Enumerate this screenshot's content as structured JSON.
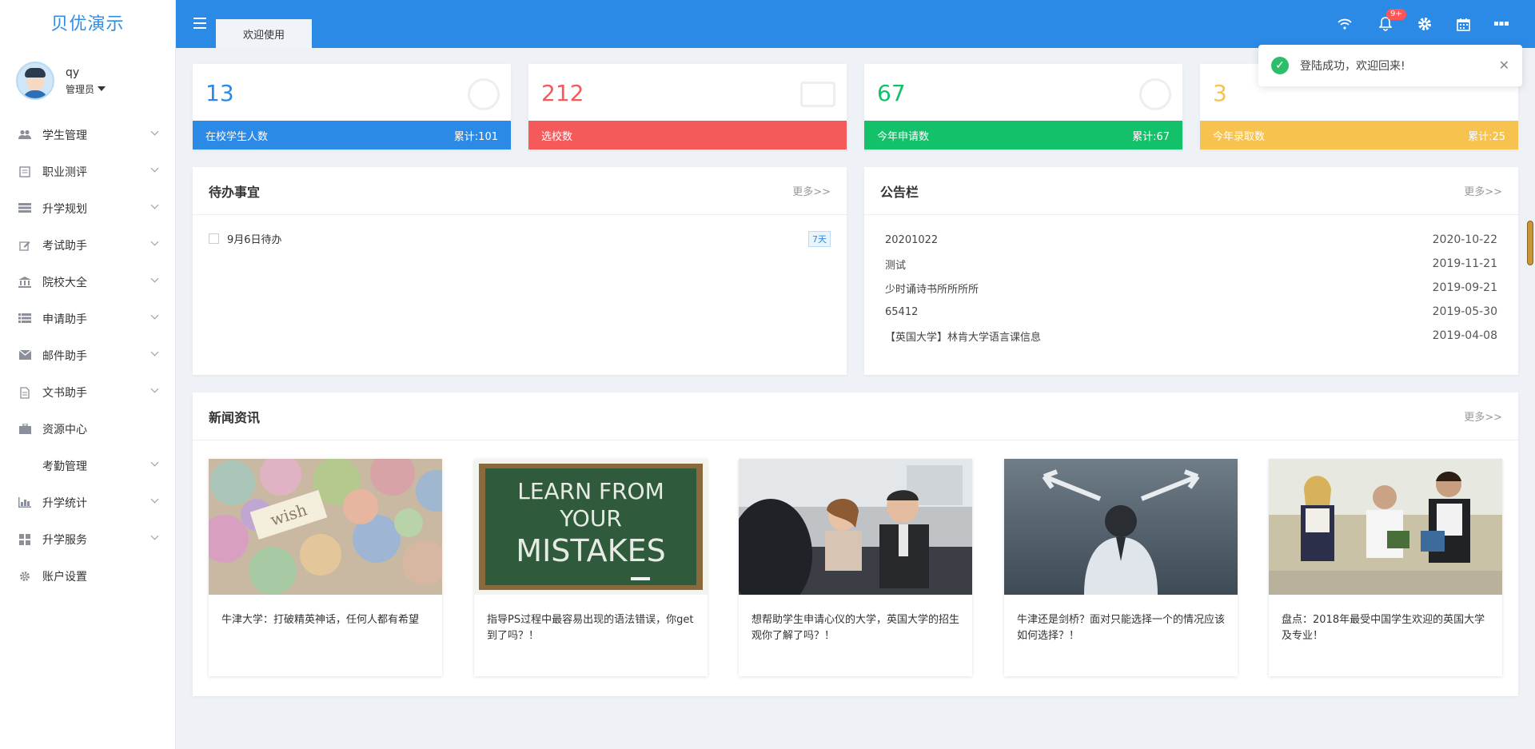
{
  "brand": "贝优演示",
  "user": {
    "name": "qy",
    "role": "管理员"
  },
  "sidebar": {
    "items": [
      {
        "label": "学生管理",
        "icon": "users-icon",
        "has_sub": true
      },
      {
        "label": "职业测评",
        "icon": "clipboard-icon",
        "has_sub": true
      },
      {
        "label": "升学规划",
        "icon": "server-icon",
        "has_sub": true
      },
      {
        "label": "考试助手",
        "icon": "edit-icon",
        "has_sub": true
      },
      {
        "label": "院校大全",
        "icon": "bank-icon",
        "has_sub": true
      },
      {
        "label": "申请助手",
        "icon": "list-icon",
        "has_sub": true
      },
      {
        "label": "邮件助手",
        "icon": "envelope-icon",
        "has_sub": true
      },
      {
        "label": "文书助手",
        "icon": "file-icon",
        "has_sub": true
      },
      {
        "label": "资源中心",
        "icon": "briefcase-icon",
        "has_sub": false
      },
      {
        "label": "考勤管理",
        "icon": "",
        "has_sub": true
      },
      {
        "label": "升学统计",
        "icon": "bar-chart-icon",
        "has_sub": true
      },
      {
        "label": "升学服务",
        "icon": "grid-icon",
        "has_sub": true
      },
      {
        "label": "账户设置",
        "icon": "gear-icon",
        "has_sub": false
      }
    ]
  },
  "header": {
    "tab": "欢迎使用",
    "badge": "9+",
    "icons": [
      "wifi-icon",
      "bell-icon",
      "gear-icon",
      "calendar-icon",
      "more-icon"
    ]
  },
  "toast": {
    "text": "登陆成功，欢迎回来!"
  },
  "stats": [
    {
      "value": "13",
      "label": "在校学生人数",
      "total": "累计:101",
      "color": "#2b8ae6"
    },
    {
      "value": "212",
      "label": "选校数",
      "total": "",
      "color": "#f55a5a"
    },
    {
      "value": "67",
      "label": "今年申请数",
      "total": "累计:67",
      "color": "#13c16a"
    },
    {
      "value": "3",
      "label": "今年录取数",
      "total": "累计:25",
      "color": "#f7c24d"
    }
  ],
  "todo": {
    "title": "待办事宜",
    "more": "更多>>",
    "items": [
      {
        "text": "9月6日待办",
        "tag": "7天"
      }
    ]
  },
  "notice": {
    "title": "公告栏",
    "more": "更多>>",
    "items": [
      {
        "title": "20201022",
        "date": "2020-10-22"
      },
      {
        "title": "测试",
        "date": "2019-11-21"
      },
      {
        "title": "少时诵诗书所所所所",
        "date": "2019-09-21"
      },
      {
        "title": "65412",
        "date": "2019-05-30"
      },
      {
        "title": "【英国大学】林肯大学语言课信息",
        "date": "2019-04-08"
      }
    ]
  },
  "news": {
    "title": "新闻资讯",
    "more": "更多>>",
    "items": [
      {
        "text": "牛津大学：打破精英神话，任何人都有希望"
      },
      {
        "text": "指导PS过程中最容易出现的语法错误，你get到了吗？！",
        "image_text": [
          "LEARN FROM",
          "YOUR",
          "MISTAKES"
        ]
      },
      {
        "text": "想帮助学生申请心仪的大学，英国大学的招生观你了解了吗？！"
      },
      {
        "text": "牛津还是剑桥？面对只能选择一个的情况应该如何选择？！"
      },
      {
        "text": "盘点：2018年最受中国学生欢迎的英国大学及专业！"
      }
    ]
  }
}
